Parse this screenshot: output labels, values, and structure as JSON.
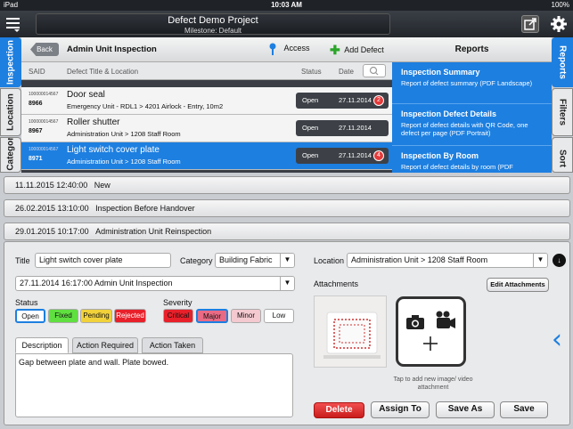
{
  "status_bar": {
    "carrier": "iPad",
    "time": "10:03 AM",
    "battery": "100%"
  },
  "header": {
    "title": "Defect Demo Project",
    "subtitle": "Milestone: Default"
  },
  "left_tabs": [
    {
      "label": "Inspection",
      "active": true
    },
    {
      "label": "Location",
      "active": false
    },
    {
      "label": "Category",
      "active": false
    }
  ],
  "right_tabs": [
    {
      "label": "Reports",
      "active": true
    },
    {
      "label": "Filters",
      "active": false
    },
    {
      "label": "Sort",
      "active": false
    }
  ],
  "list": {
    "back_label": "Back",
    "title": "Admin Unit Inspection",
    "access_label": "Access",
    "add_defect_label": "Add Defect",
    "columns": {
      "said": "SAID",
      "title": "Defect Title & Location",
      "status": "Status",
      "date": "Date"
    },
    "rows": [
      {
        "said_code": "100000014567",
        "said": "8966",
        "title": "Door seal",
        "location": "Emergency Unit - RDL1 > 4201 Airlock - Entry, 10m2",
        "status": "Open",
        "date": "27.11.2014",
        "badge": "2",
        "selected": false
      },
      {
        "said_code": "100000014567",
        "said": "8967",
        "title": "Roller shutter",
        "location": "Administration Unit > 1208 Staff Room",
        "status": "Open",
        "date": "27.11.2014",
        "badge": "",
        "selected": false
      },
      {
        "said_code": "100000014567",
        "said": "8971",
        "title": "Light switch cover plate",
        "location": "Administration Unit > 1208 Staff Room",
        "status": "Open",
        "date": "27.11.2014",
        "badge": "4",
        "selected": true
      }
    ]
  },
  "reports": {
    "title": "Reports",
    "items": [
      {
        "name": "Inspection Summary",
        "desc": "Report of defect summary (PDF Landscape)"
      },
      {
        "name": "Inspection Defect Details",
        "desc": "Report of defect details with QR Code, one defect per page (PDF Portrait)"
      },
      {
        "name": "Inspection By Room",
        "desc": "Report of defect details by room (PDF"
      }
    ]
  },
  "history": [
    {
      "datetime": "11.11.2015 12:40:00",
      "label": "New"
    },
    {
      "datetime": "26.02.2015 13:10:00",
      "label": "Inspection Before Handover"
    },
    {
      "datetime": "29.01.2015 10:17:00",
      "label": "Administration Unit Reinspection"
    }
  ],
  "form": {
    "title_label": "Title",
    "title_value": "Light switch cover plate",
    "category_label": "Category",
    "category_value": "Building Fabric",
    "location_label": "Location",
    "location_value": "Administration Unit > 1208 Staff Room",
    "inspection_value": "27.11.2014 16:17:00 Admin Unit Inspection",
    "status_label": "Status",
    "status_options": [
      "Open",
      "Fixed",
      "Pending",
      "Rejected"
    ],
    "status_selected": "Open",
    "severity_label": "Severity",
    "severity_options": [
      "Critical",
      "Major",
      "Minor",
      "Low"
    ],
    "severity_selected": "Major",
    "tabs": [
      "Description",
      "Action Required",
      "Action Taken"
    ],
    "active_tab": "Description",
    "description": "Gap between plate and wall. Plate bowed.",
    "attachments_label": "Attachments",
    "edit_attachments_label": "Edit Attachments",
    "add_media_hint": "Tap to add new image/ video attachment",
    "buttons": {
      "delete": "Delete",
      "assign": "Assign To",
      "save_as": "Save As",
      "save": "Save"
    }
  },
  "colors": {
    "accent": "#1d7fe0",
    "delete": "#d62828"
  }
}
